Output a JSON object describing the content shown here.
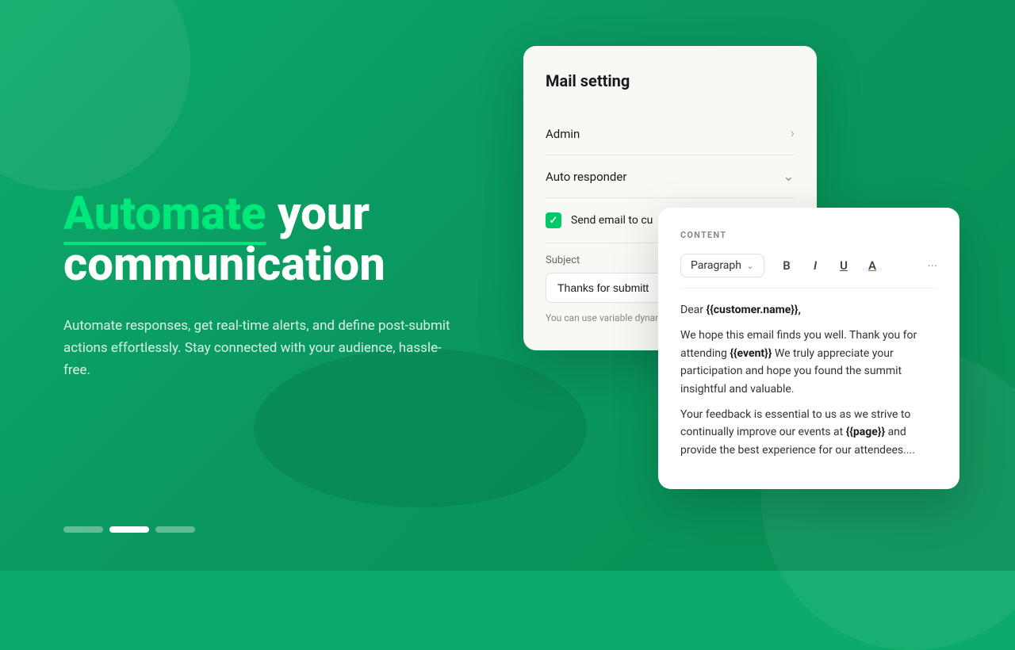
{
  "background": {
    "color": "#0dab6b"
  },
  "hero": {
    "title_highlight": "Automate",
    "title_rest": " your\ncommunication",
    "description": "Automate responses, get real-time alerts, and define post-submit actions effortlessly. Stay connected with your audience, hassle-free."
  },
  "pagination": {
    "dots": [
      "inactive",
      "active",
      "inactive"
    ]
  },
  "mail_card": {
    "title": "Mail setting",
    "admin_label": "Admin",
    "auto_responder_label": "Auto responder",
    "send_email_label": "Send email to cu",
    "subject_label": "Subject",
    "subject_value": "Thanks for submitt",
    "variable_hint": "You can use variable\ndynamic content."
  },
  "content_card": {
    "section_label": "CONTENT",
    "paragraph_selector": "Paragraph",
    "toolbar": {
      "bold": "B",
      "italic": "I",
      "underline": "U",
      "color": "A",
      "more": "···"
    },
    "body": {
      "greeting": "Dear",
      "customer_var": "{{customer.name}}",
      "line1": "We hope this email finds you well. Thank you for attending",
      "event_var": "{{event}}",
      "line2": "We truly appreciate your participation and hope you found the summit insightful and valuable.",
      "line3": "Your feedback is essential to us as we strive to continually improve our events at",
      "page_var": "{{page}}",
      "line4": "and provide the best experience for our attendees...."
    }
  }
}
